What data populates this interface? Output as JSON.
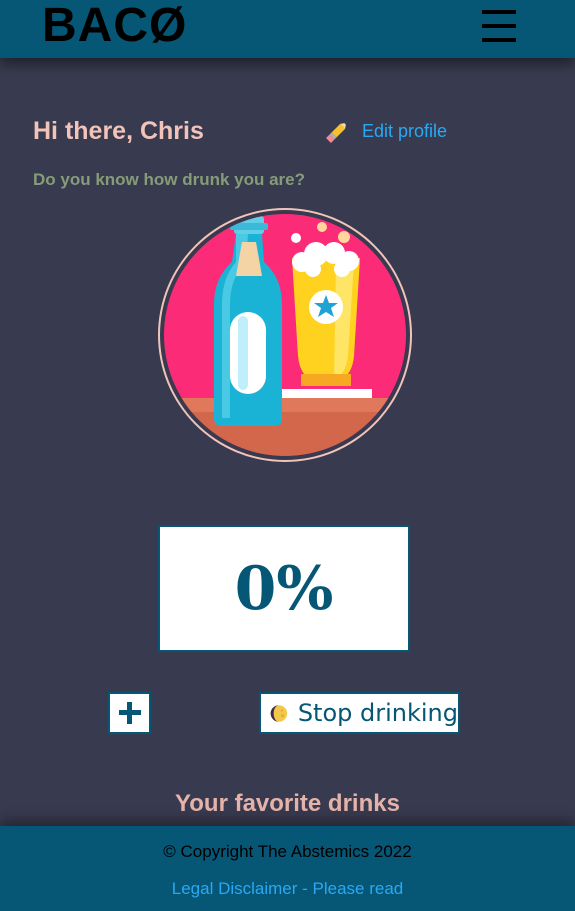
{
  "header": {
    "logo": "BACØ",
    "menu_icon": "hamburger-menu-icon"
  },
  "profile": {
    "greeting": "Hi there, Chris",
    "edit_label": "Edit profile",
    "edit_icon": "pencil-icon",
    "question": "Do you know how drunk you are?",
    "hero_image": "beer-bottle-and-glass-illustration"
  },
  "bac": {
    "value": "0%"
  },
  "actions": {
    "add_icon": "plus-icon",
    "stop_label": "Stop drinking",
    "stop_icon": "moon-icon"
  },
  "favorites": {
    "heading": "Your favorite drinks"
  },
  "footer": {
    "copyright": "© Copyright The Abstemics 2022",
    "legal": "Legal Disclaimer - Please read"
  },
  "colors": {
    "background": "#383a4f",
    "bars": "#065676",
    "accent_link": "#29a9f3",
    "greeting": "#f1c3b9",
    "question": "#869c79"
  }
}
